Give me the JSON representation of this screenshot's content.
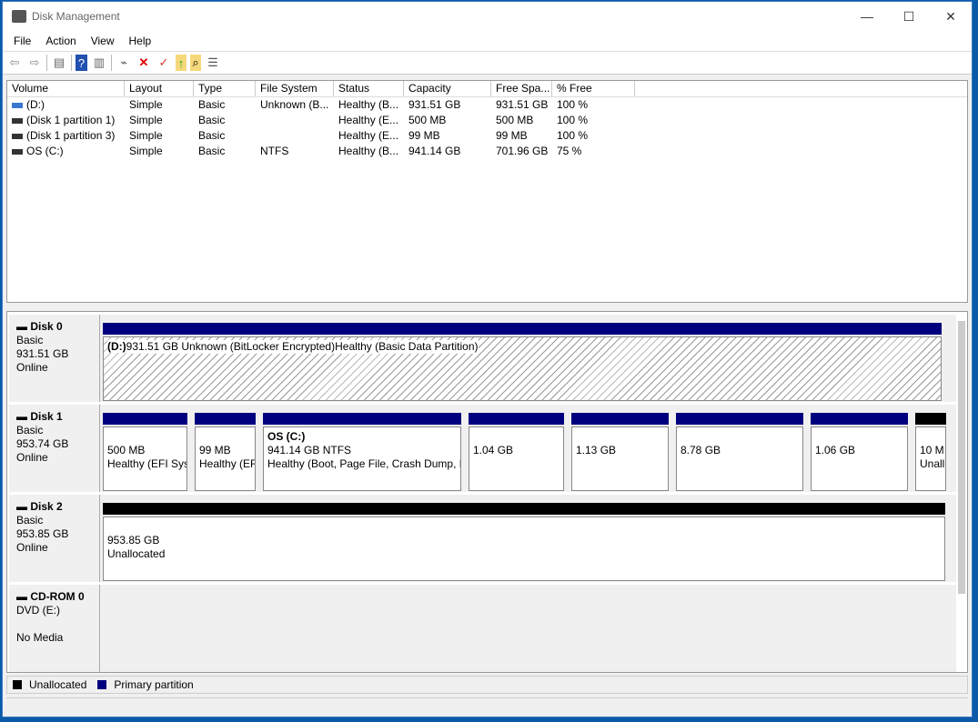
{
  "window": {
    "title": "Disk Management",
    "minimize": "—",
    "maximize": "☐",
    "close": "✕"
  },
  "menu": [
    "File",
    "Action",
    "View",
    "Help"
  ],
  "toolbar": [
    "back-icon",
    "forward-icon",
    "console-tree-icon",
    "help-icon",
    "action-pane-icon",
    "connect-disk-icon",
    "delete-icon",
    "properties-icon",
    "open-icon",
    "explore-icon",
    "settings-icon"
  ],
  "list": {
    "columns": [
      "Volume",
      "Layout",
      "Type",
      "File System",
      "Status",
      "Capacity",
      "Free Spa...",
      "% Free"
    ],
    "rows": [
      [
        "(D:)",
        "Simple",
        "Basic",
        "Unknown (B...",
        "Healthy (B...",
        "931.51 GB",
        "931.51 GB",
        "100 %"
      ],
      [
        "(Disk 1 partition 1)",
        "Simple",
        "Basic",
        "",
        "Healthy (E...",
        "500 MB",
        "500 MB",
        "100 %"
      ],
      [
        "(Disk 1 partition 3)",
        "Simple",
        "Basic",
        "",
        "Healthy (E...",
        "99 MB",
        "99 MB",
        "100 %"
      ],
      [
        "OS (C:)",
        "Simple",
        "Basic",
        "NTFS",
        "Healthy (B...",
        "941.14 GB",
        "701.96 GB",
        "75 %"
      ]
    ]
  },
  "disks": [
    {
      "name": "Disk 0",
      "type": "Basic",
      "size": "931.51 GB",
      "state": "Online",
      "parts": [
        {
          "title": "(D:)",
          "l1": "931.51 GB Unknown (BitLocker Encrypted)",
          "l2": "Healthy (Basic Data Partition)"
        }
      ]
    },
    {
      "name": "Disk 1",
      "type": "Basic",
      "size": "953.74 GB",
      "state": "Online",
      "parts": [
        {
          "l1": "500 MB",
          "l2": "Healthy (EFI Syst"
        },
        {
          "l1": "99 MB",
          "l2": "Healthy (EF"
        },
        {
          "title": "OS  (C:)",
          "l1": "941.14 GB NTFS",
          "l2": "Healthy (Boot, Page File, Crash Dump, B"
        },
        {
          "l1": "1.04 GB"
        },
        {
          "l1": "1.13 GB"
        },
        {
          "l1": "8.78 GB"
        },
        {
          "l1": "1.06 GB"
        },
        {
          "l1": "10 M",
          "l2": "Unall"
        }
      ]
    },
    {
      "name": "Disk 2",
      "type": "Basic",
      "size": "953.85 GB",
      "state": "Online",
      "parts": [
        {
          "l1": "953.85 GB",
          "l2": "Unallocated"
        }
      ]
    },
    {
      "name": "CD-ROM 0",
      "type": "DVD (E:)",
      "state": "No Media"
    }
  ],
  "legend": {
    "unallocated": "Unallocated",
    "primary": "Primary partition"
  },
  "colors": {
    "primary": "#00007f",
    "unallocated": "#000000"
  }
}
